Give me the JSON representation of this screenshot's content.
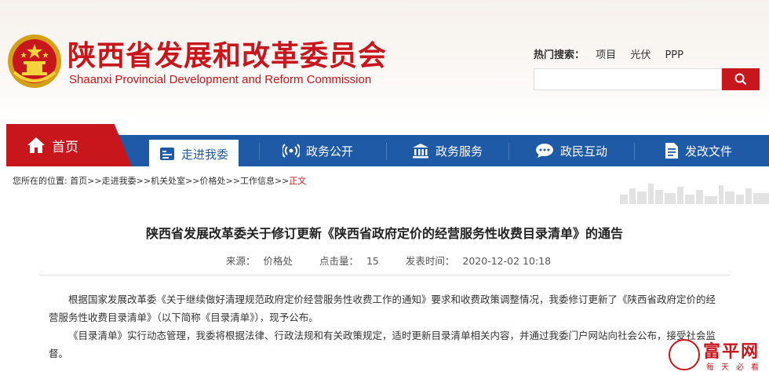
{
  "site": {
    "title_cn": "陕西省发展和改革委员会",
    "title_en": "Shaanxi Provincial Development and Reform Commission",
    "brand_color": "#c8161d",
    "nav_color": "#1f5aa6"
  },
  "search": {
    "hot_label": "热门搜索：",
    "hot_keywords": [
      "项目",
      "光伏",
      "PPP"
    ],
    "placeholder": "",
    "button_icon": "search-icon"
  },
  "nav": {
    "home": {
      "label": "首页",
      "icon": "home-icon"
    },
    "items": [
      {
        "label": "走进我委",
        "icon": "id-card-icon",
        "active": true
      },
      {
        "label": "政务公开",
        "icon": "broadcast-icon",
        "active": false
      },
      {
        "label": "政务服务",
        "icon": "building-icon",
        "active": false
      },
      {
        "label": "政民互动",
        "icon": "chat-icon",
        "active": false
      },
      {
        "label": "发改文件",
        "icon": "document-icon",
        "active": false
      }
    ]
  },
  "breadcrumb": {
    "prefix": "您所在的位置:",
    "items": [
      "首页",
      "走进我委",
      "机关处室",
      "价格处",
      "工作信息"
    ],
    "separator": ">>",
    "current": "正文"
  },
  "article": {
    "title": "陕西省发展改革委关于修订更新《陕西省政府定价的经营服务性收费目录清单》的通告",
    "source_label": "来源：",
    "source": "价格处",
    "clicks_label": "点击量：",
    "clicks": "15",
    "date_label": "发表时间：",
    "date": "2020-12-02 10:18",
    "paragraphs": [
      "根据国家发展改革委《关于继续做好清理规范政府定价经营服务性收费工作的通知》要求和收费政策调整情况，我委修订更新了《陕西省政府定价的经营服务性收费目录清单》（以下简称《目录清单》），现予公布。",
      "《目录清单》实行动态管理，我委将根据法律、行政法规和有关政策规定，适时更新目录清单相关内容，并通过我委门户网站向社会公布，接受社会监督。"
    ]
  },
  "watermark": {
    "text": "富平网",
    "sub": "每天必看"
  }
}
